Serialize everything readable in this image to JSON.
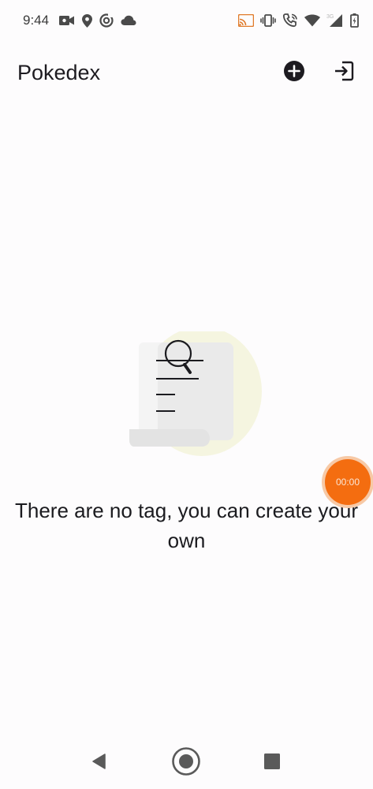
{
  "status_bar": {
    "time": "9:44",
    "left_icons": [
      "video-camera-icon",
      "location-pin-icon",
      "data-saver-icon",
      "cloud-icon"
    ],
    "right_icons": [
      "cast-icon",
      "vibrate-icon",
      "wifi-calling-icon",
      "wifi-icon",
      "mobile-signal-icon",
      "battery-icon"
    ],
    "network_label": "3G"
  },
  "app_bar": {
    "title": "Pokedex",
    "actions": [
      "add-circle-icon",
      "logout-icon"
    ]
  },
  "empty_state": {
    "illustration": "document-search-illustration",
    "message": "There are no tag, you can create your own"
  },
  "recorder": {
    "time": "00:00",
    "color": "#f46d10"
  },
  "navigation": {
    "buttons": [
      "back-icon",
      "home-icon",
      "recents-icon"
    ]
  },
  "colors": {
    "background": "#fdfcfd",
    "text": "#1b1b1f",
    "illustration_accent": "#eeefc8"
  }
}
